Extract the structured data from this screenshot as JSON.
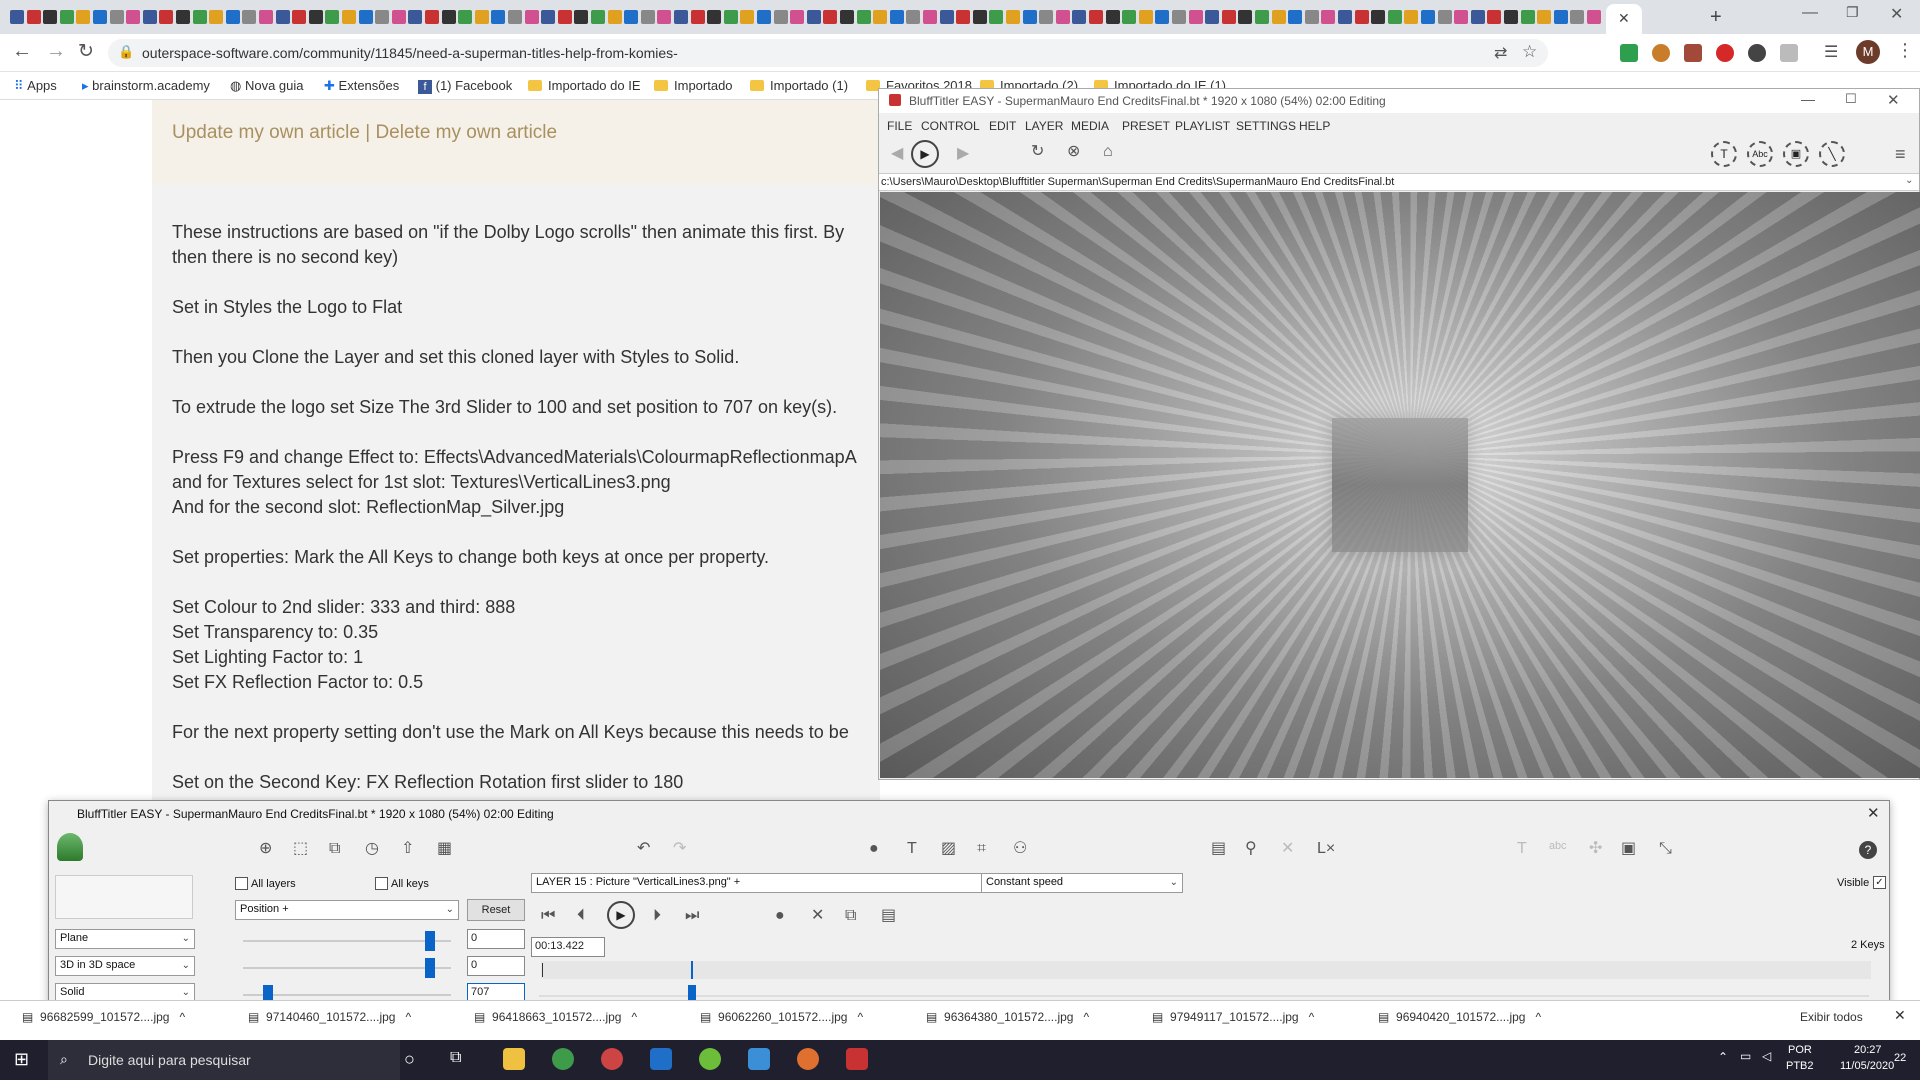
{
  "browser": {
    "url": "outerspace-software.com/community/11845/need-a-superman-titles-help-from-komies-",
    "bookmarks": [
      "Apps",
      "brainstorm.academy",
      "Nova guia",
      "Extensões",
      "(1) Facebook",
      "Importado do IE",
      "Importado",
      "Importado (1)",
      "Favoritos 2018",
      "Importado (2)",
      "Importado do IE (1)"
    ],
    "profile_initial": "M"
  },
  "article": {
    "links": "Update my own article | Delete my own article",
    "paragraphs": [
      "These instructions are based on \"if the Dolby Logo scrolls\" then animate this first. By",
      "then there is no second key)",
      "Set in Styles the Logo to Flat",
      "Then you Clone the Layer and set this cloned layer with Styles to Solid.",
      "To extrude the logo set Size The 3rd Slider to 100 and set position to 707 on key(s).",
      "Press F9 and change Effect to: Effects\\AdvancedMaterials\\ColourmapReflectionmapA",
      "and for Textures select for 1st slot: Textures\\VerticalLines3.png",
      "And for the second slot: ReflectionMap_Silver.jpg",
      "Set properties: Mark the All Keys to change both keys at once per property.",
      "Set Colour to 2nd slider: 333 and third: 888",
      "Set Transparency to: 0.35",
      "Set Lighting Factor to: 1",
      "Set FX Reflection Factor to: 0.5",
      "For the next property setting don't use the Mark on All Keys because this needs to be",
      "Set on the Second Key: FX Reflection Rotation first slider to 180"
    ]
  },
  "preview_window": {
    "title": "BluffTitler EASY  - SupermanMauro End CreditsFinal.bt * 1920 x 1080 (54%) 02:00 Editing",
    "menu": [
      "FILE",
      "CONTROL",
      "EDIT",
      "LAYER",
      "MEDIA",
      "PRESET",
      "PLAYLIST",
      "SETTINGS",
      "HELP"
    ],
    "path": "c:\\Users\\Mauro\\Desktop\\Blufftitler Superman\\Superman End Credits\\SupermanMauro End CreditsFinal.bt"
  },
  "control_window": {
    "title": "BluffTitler EASY  - SupermanMauro End CreditsFinal.bt * 1920 x 1080 (54%) 02:00 Editing",
    "all_layers": "All layers",
    "all_keys": "All keys",
    "property": "Position +",
    "reset": "Reset",
    "layer": "LAYER 15    : Picture \"VerticalLines3.png\" +",
    "speed": "Constant speed",
    "visible": "Visible",
    "time": "00:13.422",
    "keys": "2 Keys",
    "dropdown1": "Plane",
    "dropdown2": "3D in 3D space",
    "dropdown3": "Solid",
    "value1": "0",
    "value2": "0",
    "value3": "707",
    "slider_levels": [
      0.9,
      0.9,
      0.12
    ]
  },
  "downloads": {
    "files": [
      "96682599_101572....jpg",
      "97140460_101572....jpg",
      "96418663_101572....jpg",
      "96062260_101572....jpg",
      "96364380_101572....jpg",
      "97949117_101572....jpg",
      "96940420_101572....jpg"
    ],
    "show_all": "Exibir todos"
  },
  "taskbar": {
    "search": "Digite aqui para pesquisar",
    "lang": "POR",
    "layout": "PTB2",
    "time": "20:27",
    "date": "11/05/2020",
    "notifications": "22"
  }
}
